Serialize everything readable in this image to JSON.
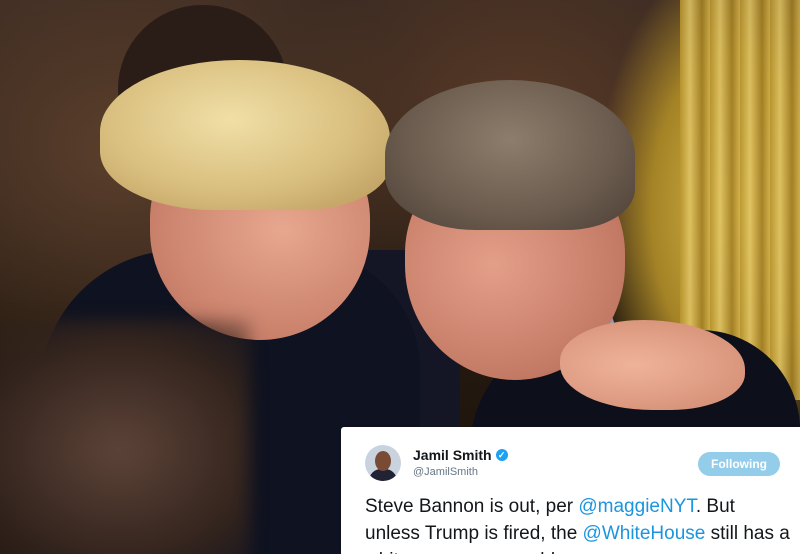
{
  "photo": {
    "description_icon": "photo-background"
  },
  "tweet": {
    "author_name": "Jamil Smith",
    "verified_icon": "verified-badge-icon",
    "handle": "@JamilSmith",
    "follow_button_label": "Following",
    "text_parts": [
      "Steve Bannon is out, per ",
      "@maggieNYT",
      ". But unless Trump is fired, the ",
      "@WhiteHouse",
      " still has a white supremacy problem."
    ],
    "colors": {
      "link": "#1b95e0",
      "follow_button": "#93cde9",
      "verified": "#1da1f2"
    }
  }
}
